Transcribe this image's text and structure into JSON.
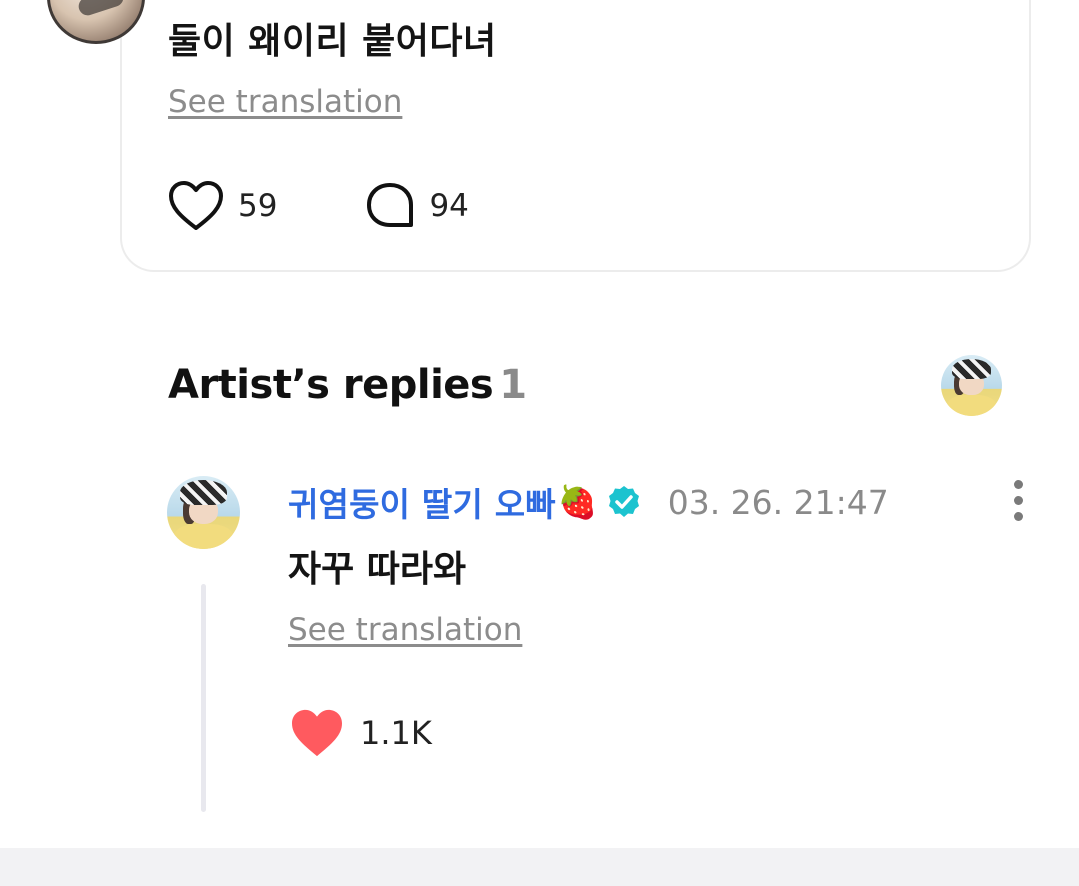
{
  "post": {
    "text": "둘이 왜이리 붙어다녀",
    "see_translation": "See translation",
    "likes": "59",
    "comments": "94"
  },
  "artist_replies": {
    "title": "Artist’s replies",
    "count": "1"
  },
  "reply": {
    "author": "귀염둥이 딸기 오빠",
    "author_emoji": "🍓",
    "verified_icon": "verified-badge-icon",
    "timestamp": "03. 26. 21:47",
    "text": "자꾸 따라와",
    "see_translation": "See translation",
    "likes": "1.1K"
  },
  "colors": {
    "author_link": "#2f6be0",
    "liked_heart": "#ff5a5f",
    "verified": "#1cc3cf",
    "muted_text": "#8a8a8a"
  }
}
